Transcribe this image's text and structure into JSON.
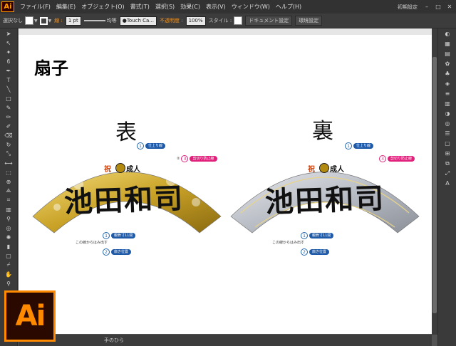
{
  "app": {
    "logo": "Ai",
    "workspace": "初期設定"
  },
  "menu": [
    "ファイル(F)",
    "編集(E)",
    "オブジェクト(O)",
    "書式(T)",
    "選択(S)",
    "効果(C)",
    "表示(V)",
    "ウィンドウ(W)",
    "ヘルプ(H)"
  ],
  "control": {
    "selection": "選択なし",
    "stroke_label": "線 :",
    "stroke_width": "1 pt",
    "profile": "均等",
    "brush": "Touch Ca...",
    "opacity_label": "不透明度 :",
    "opacity": "100%",
    "style_label": "スタイル :",
    "doc_settings": "ドキュメント設定",
    "prefs": "環境設定"
  },
  "canvas": {
    "section_title": "扇子",
    "front_label": "表",
    "back_label": "裏",
    "name_text": "池田和司",
    "celebration_text": "祝",
    "ceremony_text": "成人",
    "markers": {
      "m1_num": "1",
      "m1_text": "仕上り線",
      "m3_num_a": "②",
      "m3_num": "3",
      "m3_text": "剪切り防止線",
      "mid_num": "1",
      "mid_text": "親骨寸11間",
      "pos_num": "2",
      "pos_text": "扇き位置",
      "left_note": "この線からはみ出す",
      "small_text": "仕上り線"
    }
  },
  "status": {
    "tool": "手のひら"
  },
  "colors": {
    "accent": "#ff8a00",
    "gold": "#c9a227",
    "silver": "#b8bcc4"
  }
}
